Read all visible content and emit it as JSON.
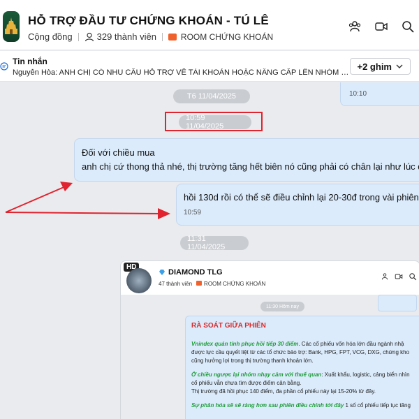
{
  "header": {
    "title": "HỖ TRỢ ĐẦU TƯ CHỨNG KHOÁN - TÚ LÊ",
    "type": "Cộng đồng",
    "members": "329 thành viên",
    "room": "ROOM CHỨNG KHOÁN",
    "actions": [
      "add-member-icon",
      "video-call-icon",
      "search-icon"
    ]
  },
  "pinned": {
    "label": "Tin nhắn",
    "text": "Nguyễn Hòa: ANH CHỊ CÓ NHU CẦU HỖ TRỢ VỀ TÀI KHOẢN HOẶC NÂNG CẤP LÊN NHÓM VIP ...",
    "pins_button": "+2 ghim"
  },
  "chat": {
    "top_bubble_time": "10:10",
    "date_pill_1": "T6 11/04/2025",
    "date_pill_2": "10:59 11/04/2025",
    "msg1_line1": "Đối với chiều mua",
    "msg1_line2": "anh chị cứ thong thả nhé, thị trường tăng hết biên nó cũng phải có chân lại như lúc d",
    "msg2_text": "hồi 130d rồi có thể sẽ điều chỉnh lại 20-30đ trong vài phiên",
    "msg2_time": "10:59",
    "date_pill_3": "11:31 11/04/2025"
  },
  "screenshot": {
    "badge": "HD",
    "group_name": "DIAMOND TLG",
    "members": "47 thành viên",
    "room": "ROOM CHỨNG KHOÁN",
    "time_pill": "11:30 Hôm nay",
    "heading": "RÀ SOÁT GIỮA PHIÊN",
    "p1_bold": "Vnindex quán tính phục hồi tiếp 30 điểm",
    "p1_rest": ". Các cổ phiếu vốn hóa lớn đầu ngành nhậ được lực cầu quyết liệt từ các tổ chức bảo trợ: Bank, HPG, FPT, VCG, DXG, chứng kho cũng hưởng lợi trong thị trường thanh khoản lớn.",
    "p2_bold": "Ở chiều ngược lại nhóm nhạy cảm với thuế quan",
    "p2_rest": ": Xuất khẩu, logistic, cảng biển nhìn cổ phiếu vẫn chưa tìm được điểm cân bằng.",
    "p3": "Thị trường đã hồi phục 140 điểm, đa phần cổ phiếu này lại 15-20% từ đây.",
    "p4_bold": "Sự phân hóa sẽ sẽ ràng hơn sau phiên điều chỉnh tới đây",
    "p4_rest": " 1 số cổ phiếu tiếp tục tăng"
  },
  "colors": {
    "bubble": "#dbebfb",
    "annotation_red": "#e0232e",
    "room_tag": "#f0622d"
  }
}
